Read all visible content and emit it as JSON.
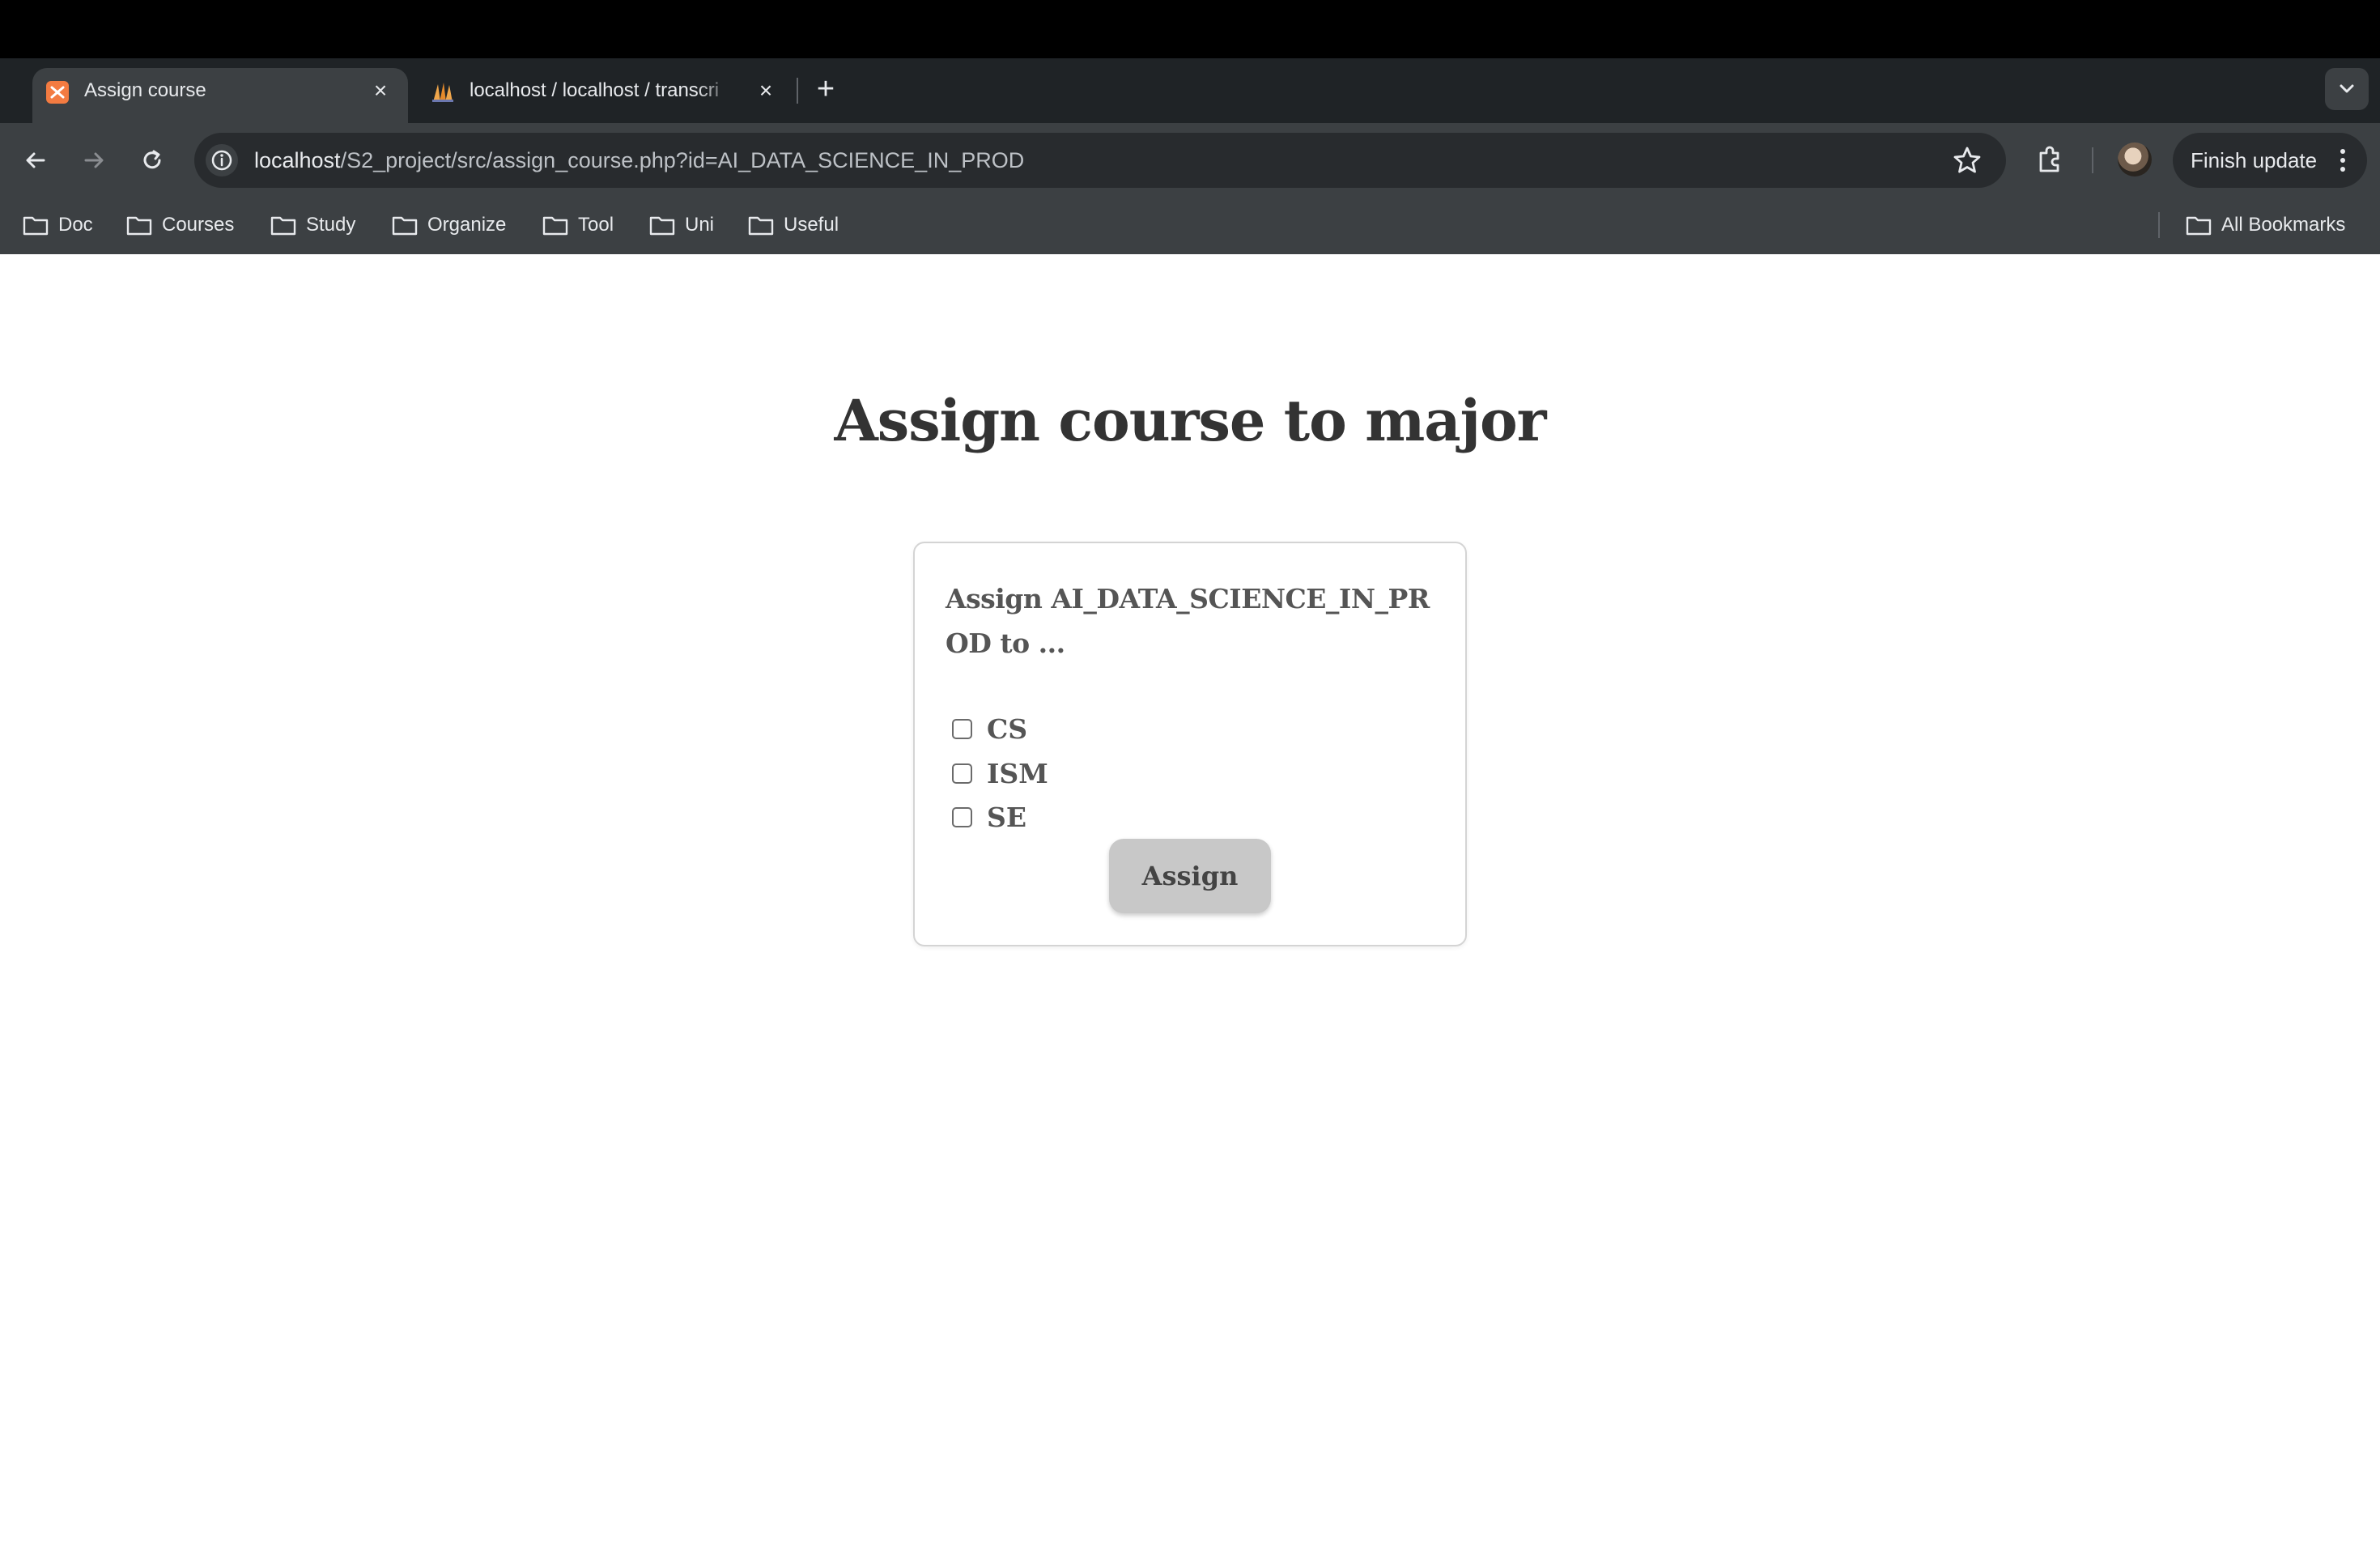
{
  "browser": {
    "tabs": [
      {
        "title": "Assign course",
        "active": true,
        "favicon": "xampp-icon"
      },
      {
        "title": "localhost / localhost / transcri",
        "active": false,
        "favicon": "phpmyadmin-icon"
      }
    ],
    "url_host": "localhost",
    "url_path": "/S2_project/src/assign_course.php?id=AI_DATA_SCIENCE_IN_PROD",
    "finish_update_label": "Finish update",
    "bookmarks": [
      "Doc",
      "Courses",
      "Study",
      "Organize",
      "Tool",
      "Uni",
      "Useful"
    ],
    "all_bookmarks_label": "All Bookmarks"
  },
  "page": {
    "title": "Assign course to major",
    "legend": "Assign AI_DATA_SCIENCE_IN_PROD to ...",
    "majors": [
      {
        "label": "CS",
        "checked": false
      },
      {
        "label": "ISM",
        "checked": false
      },
      {
        "label": "SE",
        "checked": false
      }
    ],
    "submit_label": "Assign"
  },
  "colors": {
    "chrome_dark": "#1f2326",
    "toolbar": "#3c4043",
    "heading_text": "#333333",
    "button_bg": "#c8c8c8"
  }
}
